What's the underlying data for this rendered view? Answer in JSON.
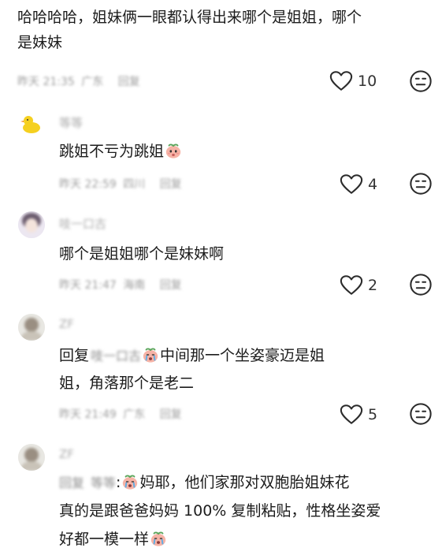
{
  "top_comment": {
    "line1": "哈哈哈哈，姐妹俩一眼都认得出来哪个是姐姐，哪个",
    "line2": "是妹妹",
    "time": "昨天 21:35",
    "location": "广东",
    "reply_label": "回复",
    "likes": "10"
  },
  "replies": [
    {
      "username": "等等",
      "text": "跳姐不亏为跳姐",
      "time": "昨天 22:59",
      "location": "四川",
      "reply_label": "回复",
      "likes": "4"
    },
    {
      "username": "吱一口古",
      "text": "哪个是姐姐哪个是妹妹啊",
      "time": "昨天 21:47",
      "location": "海南",
      "reply_label": "回复",
      "likes": "2"
    },
    {
      "username": "ZF",
      "reply_prefix": "回复",
      "mention": "吱一口古",
      "text_line1": "中间那一个坐姿豪迈是姐",
      "text_line2": "姐，角落那个是老二",
      "time": "昨天 21:49",
      "location": "广东",
      "reply_label": "回复",
      "likes": "5"
    },
    {
      "username": "ZF",
      "reply_prefix": "回复",
      "mention": "等等",
      "colon": ":",
      "text_line1": "妈耶，他们家那对双胞胎姐妹花",
      "text_line2": "真的是跟爸爸妈妈 100% 复制粘贴，性格坐姿爱",
      "text_line3": "好都一模一样"
    }
  ],
  "icons": {
    "like": "heart-outline-icon",
    "dislike": "meh-face-icon",
    "emoji": "peach-face-emoji"
  }
}
